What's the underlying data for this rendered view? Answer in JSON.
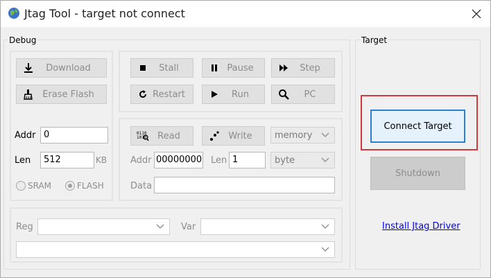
{
  "window": {
    "title": "Jtag Tool - target not connect"
  },
  "debug": {
    "group_label": "Debug",
    "download_label": "Download",
    "erase_flash_label": "Erase Flash",
    "addr_label": "Addr",
    "addr_value": "0",
    "len_label": "Len",
    "len_value": "512",
    "len_unit": "KB",
    "sram_label": "SRAM",
    "flash_label": "FLASH",
    "selected_memory": "FLASH"
  },
  "control": {
    "stall_label": "Stall",
    "pause_label": "Pause",
    "step_label": "Step",
    "restart_label": "Restart",
    "run_label": "Run",
    "pc_label": "PC"
  },
  "memory": {
    "read_label": "Read",
    "write_label": "Write",
    "type_selected": "memory",
    "addr_label": "Addr",
    "addr_value": "00000000",
    "len_label": "Len",
    "len_value": "1",
    "width_selected": "byte",
    "data_label": "Data",
    "data_value": ""
  },
  "watch": {
    "reg_label": "Reg",
    "reg_value": "",
    "var_label": "Var",
    "var_value": "",
    "expr_value": ""
  },
  "target": {
    "group_label": "Target",
    "connect_label": "Connect Target",
    "shutdown_label": "Shutdown",
    "driver_link": "Install Jtag Driver"
  },
  "colors": {
    "highlight_outline": "#d03a3a",
    "focus_border": "#2f7fd1",
    "link": "#0000ee"
  },
  "icons": [
    "app-globe-icon",
    "close-icon",
    "download-icon",
    "erase-brush-icon",
    "stop-icon",
    "pause-icon",
    "step-icon",
    "restart-icon",
    "play-icon",
    "search-icon",
    "binary-read-icon",
    "write-icon",
    "chevron-down-icon"
  ]
}
